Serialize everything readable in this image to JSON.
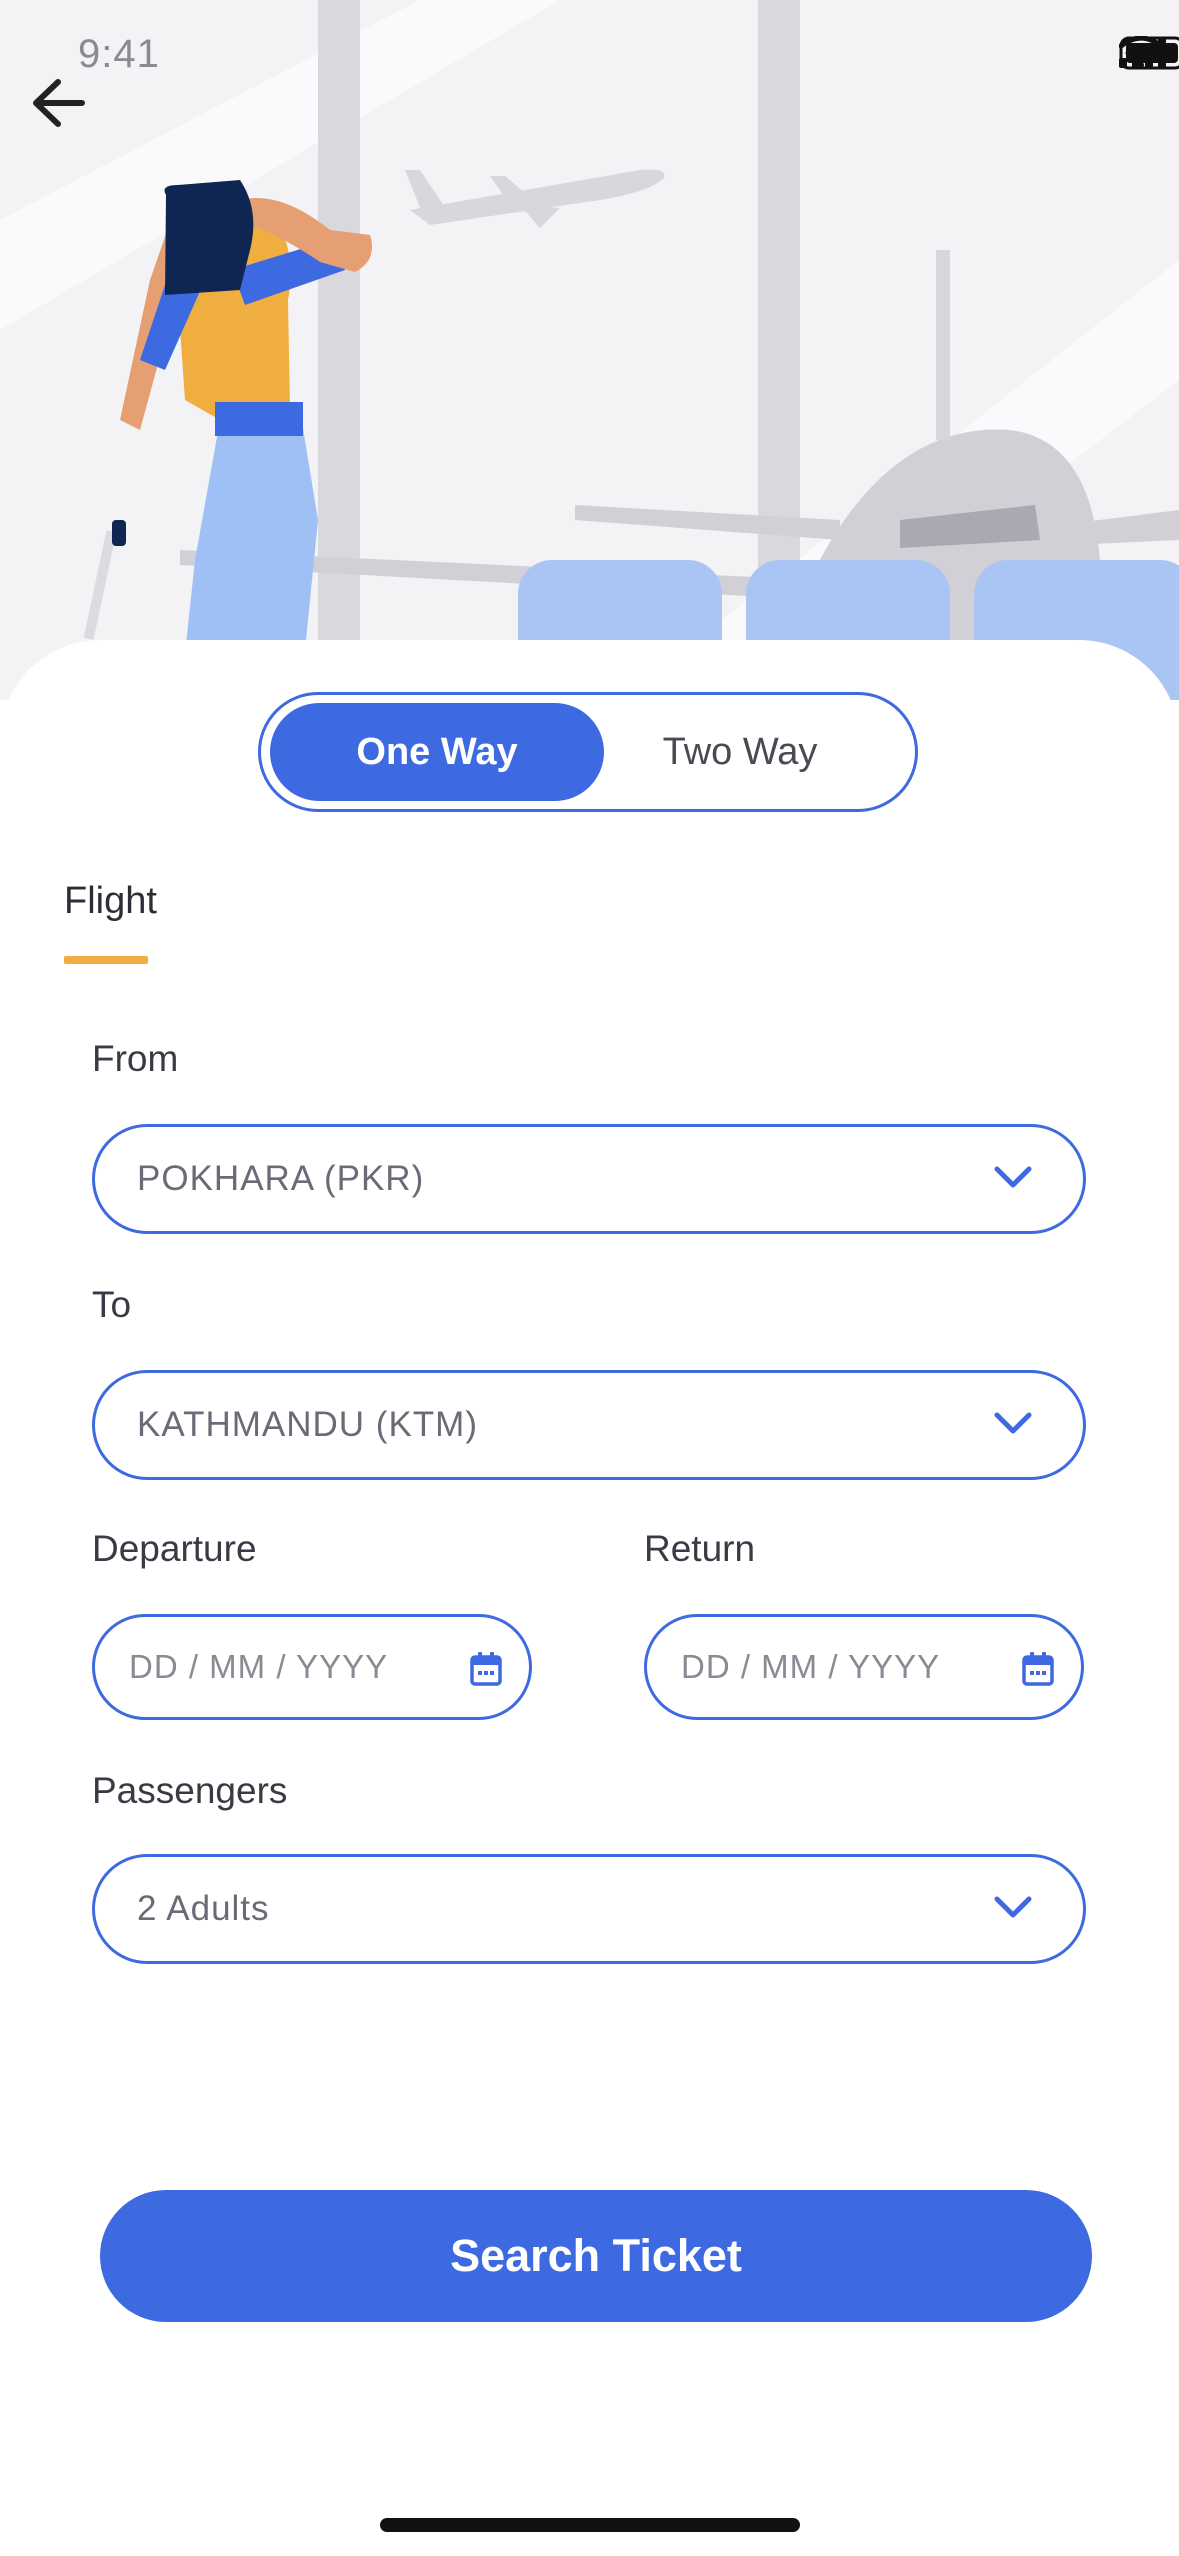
{
  "status_bar": {
    "time": "9:41",
    "icons": [
      "signal-icon",
      "wifi-icon",
      "battery-icon"
    ]
  },
  "header": {
    "back_icon": "arrow-left-icon"
  },
  "trip_toggle": {
    "one_way": "One Way",
    "two_way": "Two Way",
    "selected": "One Way"
  },
  "tabs": {
    "flight": "Flight"
  },
  "form": {
    "from": {
      "label": "From",
      "value": "POKHARA (PKR)"
    },
    "to": {
      "label": "To",
      "value": "KATHMANDU (KTM)"
    },
    "departure": {
      "label": "Departure",
      "placeholder": "DD / MM / YYYY"
    },
    "return": {
      "label": "Return",
      "placeholder": "DD / MM / YYYY"
    },
    "passengers": {
      "label": "Passengers",
      "value": "2 Adults"
    }
  },
  "actions": {
    "search": "Search Ticket"
  },
  "colors": {
    "accent": "#3e6ae1",
    "highlight": "#f0ae40",
    "hero_bg": "#f3f3f6"
  }
}
